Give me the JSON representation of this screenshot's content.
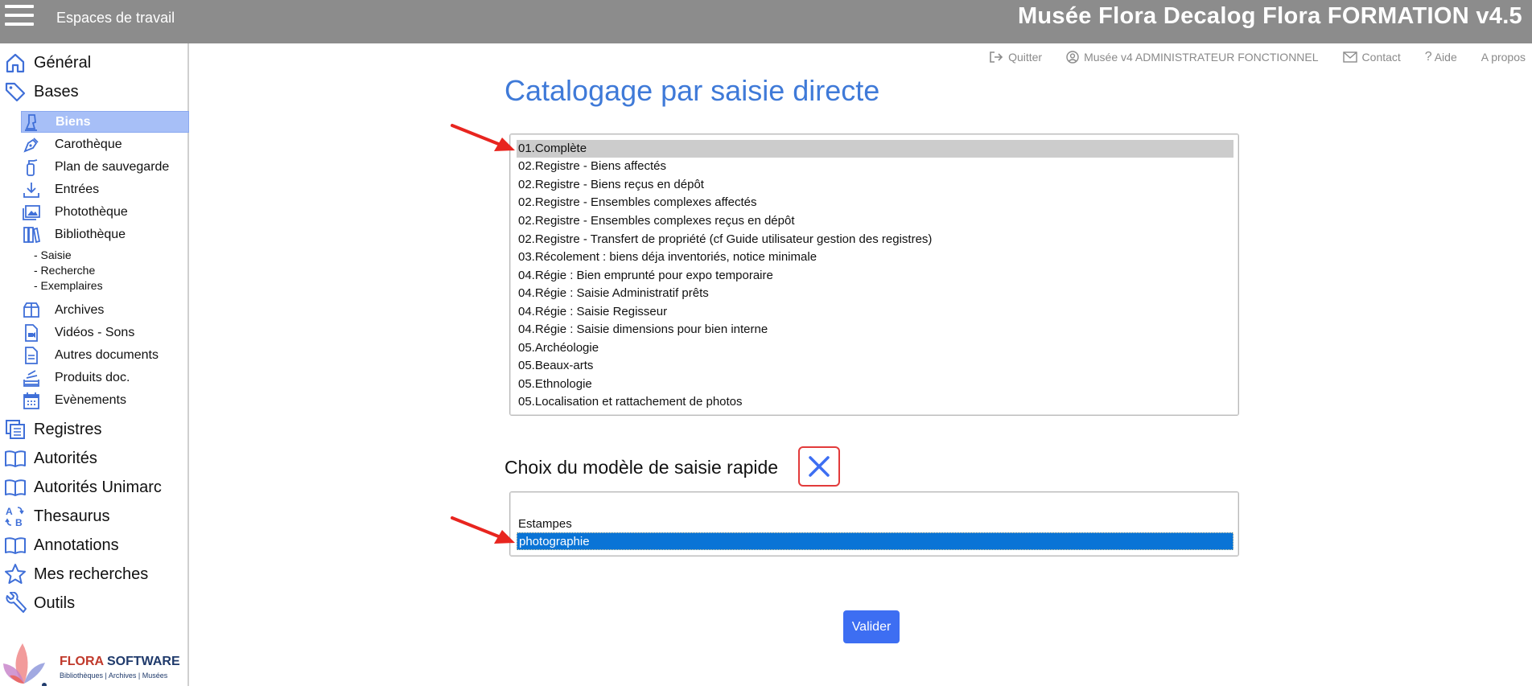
{
  "topbar": {
    "workspaces_label": "Espaces de travail",
    "app_title": "Musée Flora Decalog Flora FORMATION v4.5"
  },
  "userbar": {
    "quit": "Quitter",
    "user": "Musée v4 ADMINISTRATEUR FONCTIONNEL",
    "contact": "Contact",
    "help": "Aide",
    "about": "A propos"
  },
  "sidebar": {
    "general": "Général",
    "bases": "Bases",
    "biens": "Biens",
    "carotheque": "Carothèque",
    "plan_sauvegarde": "Plan de sauvegarde",
    "entrees": "Entrées",
    "phototheque": "Photothèque",
    "bibliotheque": "Bibliothèque",
    "saisie": "- Saisie",
    "recherche": "- Recherche",
    "exemplaires": "- Exemplaires",
    "archives": "Archives",
    "videos_sons": "Vidéos - Sons",
    "autres_documents": "Autres documents",
    "produits_doc": "Produits doc.",
    "evenements": "Evènements",
    "registres": "Registres",
    "autorites": "Autorités",
    "autorites_unimarc": "Autorités Unimarc",
    "thesaurus": "Thesaurus",
    "annotations": "Annotations",
    "mes_recherches": "Mes recherches",
    "outils": "Outils"
  },
  "logo": {
    "brand_flora": "FLORA",
    "brand_software": "SOFTWARE",
    "tagline": "Bibliothèques | Archives | Musées"
  },
  "main": {
    "title": "Catalogage par saisie directe",
    "models": [
      "01.Complète",
      "02.Registre - Biens affectés",
      "02.Registre - Biens reçus en dépôt",
      "02.Registre - Ensembles complexes affectés",
      "02.Registre - Ensembles complexes reçus en dépôt",
      "02.Registre - Transfert de propriété (cf Guide utilisateur gestion des registres)",
      "03.Récolement : biens déja inventoriés, notice minimale",
      "04.Régie : Bien emprunté pour expo temporaire",
      "04.Régie : Saisie Administratif prêts",
      "04.Régie : Saisie Regisseur",
      "04.Régie : Saisie dimensions pour bien interne",
      "05.Archéologie",
      "05.Beaux-arts",
      "05.Ethnologie",
      "05.Localisation et rattachement de photos"
    ],
    "models_selected": "01.Complète",
    "quick_title": "Choix du modèle de saisie rapide",
    "quick_models": [
      "",
      "Estampes",
      "photographie"
    ],
    "quick_selected": "photographie",
    "validate_label": "Valider"
  },
  "colors": {
    "topbar": "#8c8c8c",
    "accent_blue": "#3f7ad8",
    "selection_blue": "#0a74d6",
    "button_blue": "#3d6ef2",
    "annotation_red": "#e23b3b"
  }
}
